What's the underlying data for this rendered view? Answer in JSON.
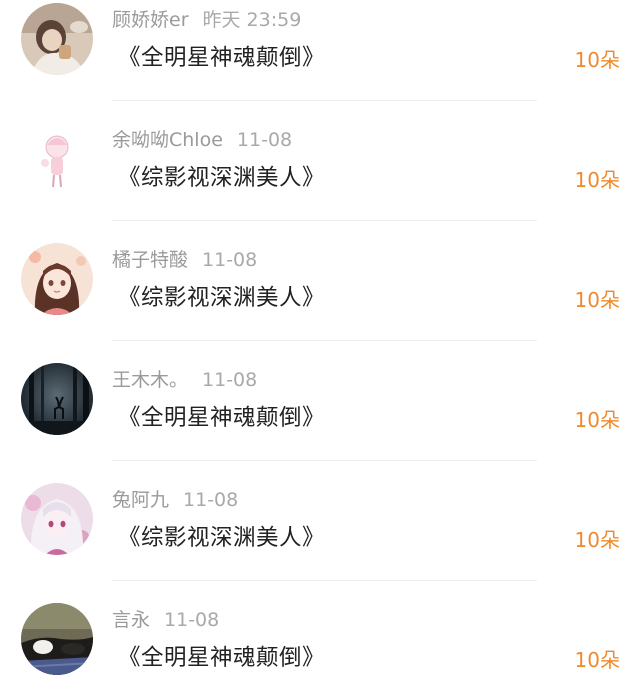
{
  "accent_color": "#ef8a2c",
  "items": [
    {
      "name": "顾娇娇er",
      "time": "昨天 23:59",
      "title": "《全明星神魂颠倒》",
      "count": "10朵",
      "avatar": "girl-with-cup-photo-avatar"
    },
    {
      "name": "余呦呦Chloe",
      "time": "11-08",
      "title": "《综影视深渊美人》",
      "count": "10朵",
      "avatar": "chibi-girl-sketch-avatar"
    },
    {
      "name": "橘子特酸",
      "time": "11-08",
      "title": "《综影视深渊美人》",
      "count": "10朵",
      "avatar": "anime-girl-avatar"
    },
    {
      "name": "王木木。",
      "time": "11-08",
      "title": "《全明星神魂颠倒》",
      "count": "10朵",
      "avatar": "dark-forest-deer-avatar"
    },
    {
      "name": "兔阿九",
      "time": "11-08",
      "title": "《综影视深渊美人》",
      "count": "10朵",
      "avatar": "white-hair-anime-girl-avatar"
    },
    {
      "name": "言永",
      "time": "11-08",
      "title": "《全明星神魂颠倒》",
      "count": "10朵",
      "avatar": "cat-photo-avatar"
    }
  ]
}
